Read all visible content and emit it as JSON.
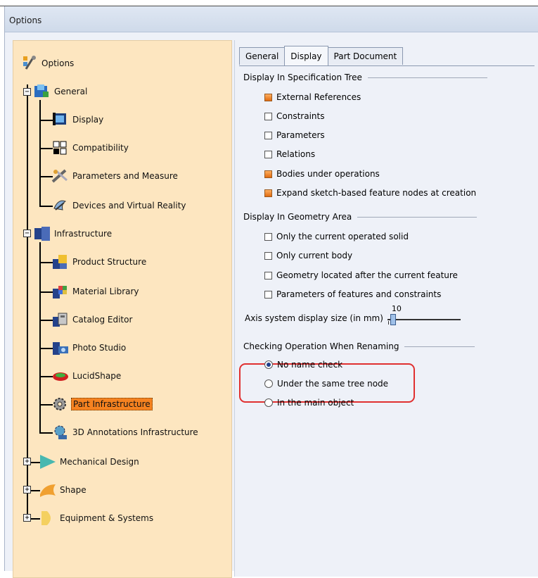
{
  "window": {
    "title": "Options"
  },
  "tree": {
    "root": {
      "label": "Options",
      "icon": "options-tree-icon"
    },
    "general": {
      "label": "General",
      "icon": "general-icon",
      "expander": "−",
      "children": [
        {
          "label": "Display",
          "icon": "display-icon"
        },
        {
          "label": "Compatibility",
          "icon": "compatibility-icon"
        },
        {
          "label": "Parameters and Measure",
          "icon": "parameters-icon"
        },
        {
          "label": "Devices and Virtual Reality",
          "icon": "devices-icon"
        }
      ]
    },
    "infrastructure": {
      "label": "Infrastructure",
      "icon": "infrastructure-icon",
      "expander": "−",
      "children": [
        {
          "label": "Product Structure",
          "icon": "product-structure-icon"
        },
        {
          "label": "Material Library",
          "icon": "material-library-icon"
        },
        {
          "label": "Catalog Editor",
          "icon": "catalog-editor-icon"
        },
        {
          "label": "Photo Studio",
          "icon": "photo-studio-icon"
        },
        {
          "label": "LucidShape",
          "icon": "lucidshape-icon"
        },
        {
          "label": "Part Infrastructure",
          "icon": "gear-icon",
          "selected": true
        },
        {
          "label": "3D Annotations Infrastructure",
          "icon": "annotations-icon"
        }
      ]
    },
    "collapsed": [
      {
        "label": "Mechanical Design",
        "icon": "mechanical-design-icon",
        "expander": "+"
      },
      {
        "label": "Shape",
        "icon": "shape-icon",
        "expander": "+"
      },
      {
        "label": "Equipment & Systems",
        "icon": "equipment-icon",
        "expander": "+"
      }
    ]
  },
  "tabs": [
    {
      "label": "General",
      "active": false
    },
    {
      "label": "Display",
      "active": true
    },
    {
      "label": "Part Document",
      "active": false
    }
  ],
  "spec_tree": {
    "title": "Display In Specification Tree",
    "options": [
      {
        "label": "External References",
        "checked": true
      },
      {
        "label": "Constraints",
        "checked": false
      },
      {
        "label": "Parameters",
        "checked": false
      },
      {
        "label": "Relations",
        "checked": false
      },
      {
        "label": "Bodies under operations",
        "checked": true
      },
      {
        "label": "Expand sketch-based feature nodes at creation",
        "checked": true
      }
    ]
  },
  "geometry_area": {
    "title": "Display In Geometry Area",
    "options": [
      {
        "label": "Only the current operated solid",
        "checked": false
      },
      {
        "label": "Only current body",
        "checked": false
      },
      {
        "label": "Geometry located after the current feature",
        "checked": false
      },
      {
        "label": "Parameters of features and constraints",
        "checked": false
      }
    ],
    "axis_label": "Axis system display size (in mm)",
    "axis_value": "10"
  },
  "renaming": {
    "title": "Checking Operation When Renaming",
    "options": [
      {
        "label": "No name check",
        "selected": true
      },
      {
        "label": "Under the same tree node",
        "selected": false
      },
      {
        "label": "In the main object",
        "selected": false
      }
    ],
    "highlight_color": "#e03030"
  },
  "colors": {
    "tree_bg": "#fde6c0",
    "selection": "#f58220",
    "panel_bg": "#eef1f8"
  }
}
